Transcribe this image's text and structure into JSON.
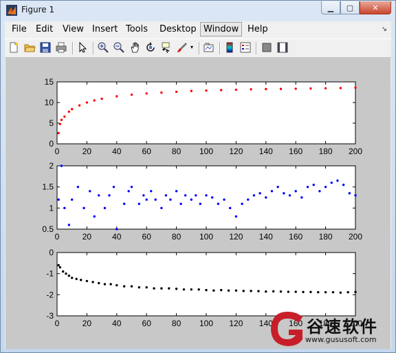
{
  "window": {
    "title": "Figure 1",
    "min_glyph": "▁",
    "max_glyph": "▢",
    "close_glyph": "✕"
  },
  "menubar": {
    "items": [
      "File",
      "Edit",
      "View",
      "Insert",
      "Tools",
      "Desktop",
      "Window",
      "Help"
    ],
    "active": "Window",
    "dock_glyph": "↘"
  },
  "toolbar": {
    "buttons": [
      "new-figure-icon",
      "open-file-icon",
      "save-icon",
      "print-icon",
      "edit-plot-icon",
      "zoom-in-icon",
      "zoom-out-icon",
      "pan-icon",
      "rotate-3d-icon",
      "data-cursor-icon",
      "brush-icon",
      "link-plot-icon",
      "colorbar-icon",
      "legend-icon",
      "hide-plot-tools-icon",
      "show-plot-tools-icon"
    ]
  },
  "watermark": {
    "brand_cn": "谷速软件",
    "url": "www.gususoft.com"
  },
  "colors": {
    "series1": "#ff0000",
    "series2": "#0000ff",
    "series3": "#000000",
    "figure_bg": "#c8c8c8",
    "axes_bg": "#ffffff"
  },
  "chart_data": [
    {
      "type": "scatter",
      "marker": "dot",
      "xlim": [
        0,
        200
      ],
      "ylim": [
        0,
        15
      ],
      "xticks": [
        "0",
        "20",
        "40",
        "60",
        "80",
        "100",
        "120",
        "140",
        "160",
        "180",
        "200"
      ],
      "yticks": [
        "0",
        "5",
        "10",
        "15"
      ],
      "series": [
        {
          "color": "#ff0000",
          "x": [
            1,
            2,
            3,
            5,
            8,
            10,
            15,
            20,
            25,
            30,
            40,
            50,
            60,
            70,
            80,
            90,
            100,
            110,
            120,
            130,
            140,
            150,
            160,
            170,
            180,
            190,
            200
          ],
          "y": [
            2.6,
            4.8,
            5.8,
            6.6,
            7.8,
            8.4,
            9.3,
            10.0,
            10.5,
            10.9,
            11.5,
            11.9,
            12.2,
            12.4,
            12.6,
            12.8,
            12.9,
            13.0,
            13.1,
            13.2,
            13.25,
            13.3,
            13.35,
            13.4,
            13.45,
            13.5,
            13.6
          ]
        }
      ]
    },
    {
      "type": "scatter",
      "marker": "dot",
      "xlim": [
        0,
        200
      ],
      "ylim": [
        0.5,
        2
      ],
      "xticks": [
        "0",
        "20",
        "40",
        "60",
        "80",
        "100",
        "120",
        "140",
        "160",
        "180",
        "200"
      ],
      "yticks": [
        "0.5",
        "1",
        "1.5",
        "2"
      ],
      "series": [
        {
          "color": "#0000ff",
          "x": [
            1,
            3,
            5,
            8,
            10,
            14,
            18,
            22,
            25,
            28,
            32,
            35,
            38,
            40,
            45,
            48,
            50,
            55,
            58,
            60,
            63,
            66,
            70,
            73,
            76,
            80,
            83,
            86,
            90,
            93,
            96,
            100,
            104,
            108,
            112,
            116,
            120,
            124,
            128,
            132,
            136,
            140,
            144,
            148,
            152,
            156,
            160,
            164,
            168,
            172,
            176,
            180,
            184,
            188,
            192,
            196,
            200
          ],
          "y": [
            1.2,
            2.0,
            1.0,
            0.6,
            1.2,
            1.5,
            1.0,
            1.4,
            0.8,
            1.3,
            1.0,
            1.3,
            1.5,
            0.5,
            1.1,
            1.4,
            1.5,
            1.1,
            1.3,
            1.2,
            1.4,
            1.2,
            1.0,
            1.3,
            1.2,
            1.4,
            1.1,
            1.3,
            1.2,
            1.3,
            1.1,
            1.3,
            1.25,
            1.1,
            1.2,
            1.0,
            0.8,
            1.1,
            1.2,
            1.3,
            1.35,
            1.25,
            1.4,
            1.5,
            1.35,
            1.3,
            1.4,
            1.25,
            1.5,
            1.55,
            1.4,
            1.5,
            1.6,
            1.65,
            1.55,
            1.35,
            1.3
          ]
        }
      ]
    },
    {
      "type": "scatter",
      "marker": "dot",
      "xlim": [
        0,
        200
      ],
      "ylim": [
        -3,
        0
      ],
      "xticks": [
        "0",
        "20",
        "40",
        "60",
        "80",
        "100",
        "120",
        "140",
        "160",
        "180",
        "200"
      ],
      "yticks": [
        "0",
        "-1",
        "-2",
        "-3"
      ],
      "series": [
        {
          "color": "#000000",
          "x": [
            1,
            2,
            4,
            6,
            8,
            10,
            13,
            16,
            20,
            24,
            28,
            32,
            36,
            40,
            45,
            50,
            55,
            60,
            65,
            70,
            75,
            80,
            85,
            90,
            95,
            100,
            105,
            110,
            115,
            120,
            125,
            130,
            135,
            140,
            145,
            150,
            155,
            160,
            165,
            170,
            175,
            180,
            185,
            190,
            195,
            200
          ],
          "y": [
            -0.6,
            -0.7,
            -0.9,
            -1.0,
            -1.1,
            -1.2,
            -1.25,
            -1.3,
            -1.35,
            -1.4,
            -1.45,
            -1.5,
            -1.5,
            -1.55,
            -1.6,
            -1.6,
            -1.65,
            -1.65,
            -1.7,
            -1.7,
            -1.7,
            -1.72,
            -1.75,
            -1.75,
            -1.75,
            -1.78,
            -1.8,
            -1.78,
            -1.8,
            -1.8,
            -1.82,
            -1.82,
            -1.83,
            -1.85,
            -1.84,
            -1.85,
            -1.86,
            -1.86,
            -1.87,
            -1.87,
            -1.88,
            -1.88,
            -1.88,
            -1.9,
            -1.88,
            -1.87
          ]
        }
      ]
    }
  ]
}
